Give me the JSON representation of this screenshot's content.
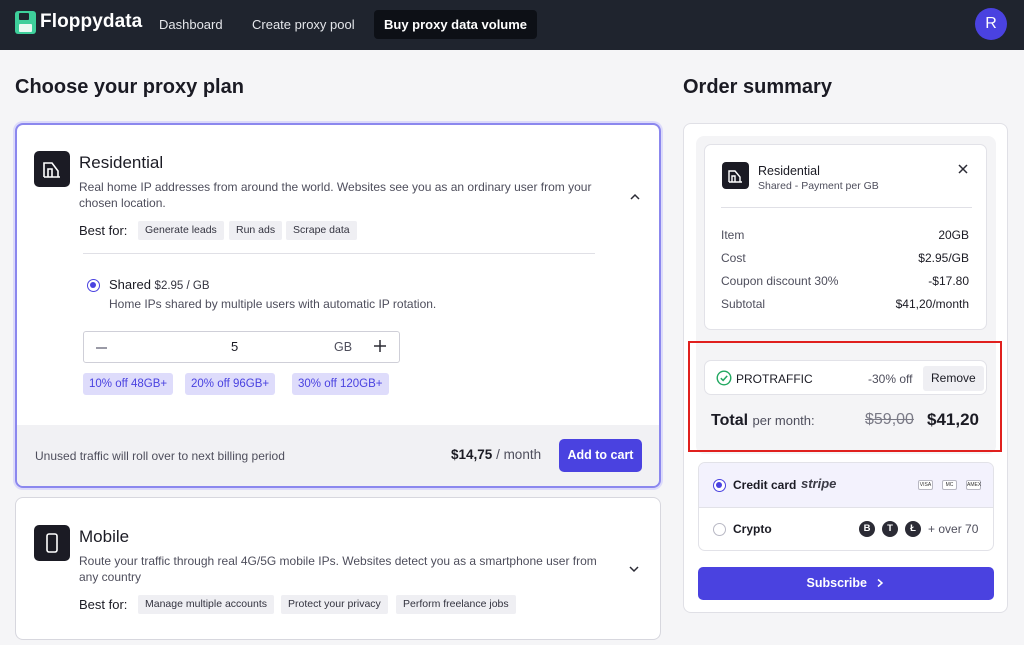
{
  "app": {
    "name": "Floppydata"
  },
  "nav": {
    "links": [
      {
        "label": "Dashboard"
      },
      {
        "label": "Create proxy pool"
      },
      {
        "label": "Buy proxy data volume"
      }
    ],
    "avatar_initial": "R"
  },
  "plans_heading": "Choose your proxy plan",
  "plans": [
    {
      "title": "Residential",
      "description_line1": "Real home IP addresses from around the world. Websites see you as an ordinary user from your",
      "description_line2": "chosen location.",
      "best_for_label": "Best for:",
      "tags": [
        "Generate leads",
        "Run ads",
        "Scrape data"
      ],
      "option": {
        "label": "Shared",
        "price": "$2.95 / GB",
        "description": "Home IPs shared by multiple users with automatic IP rotation."
      },
      "quantity": {
        "value": "5",
        "unit": "GB"
      },
      "discounts": [
        "10% off 48GB+",
        "20% off 96GB+",
        "30% off 120GB+"
      ],
      "footer_note": "Unused traffic will roll over to next billing period",
      "price": "$14,75",
      "price_period": "/ month",
      "add_to_cart_label": "Add to cart"
    },
    {
      "title": "Mobile",
      "description_line1": "Route your traffic through real 4G/5G mobile IPs. Websites detect you as a smartphone user from",
      "description_line2": "any country",
      "best_for_label": "Best for:",
      "tags": [
        "Manage multiple accounts",
        "Protect your privacy",
        "Perform freelance jobs"
      ]
    }
  ],
  "summary": {
    "heading": "Order summary",
    "item_title": "Residential",
    "item_subtitle": "Shared - Payment per GB",
    "rows": [
      {
        "label": "Item",
        "value": "20GB"
      },
      {
        "label": "Cost",
        "value": "$2.95/GB"
      },
      {
        "label": "Coupon discount 30%",
        "value": "-$17.80"
      },
      {
        "label": "Subtotal",
        "value": "$41,20/month"
      }
    ],
    "coupon": {
      "code": "PROTRAFFIC",
      "discount": "-30% off",
      "remove_label": "Remove"
    },
    "total": {
      "label": "Total",
      "per": "per month:",
      "old": "$59,00",
      "new": "$41,20"
    },
    "payment": {
      "credit": {
        "label": "Credit card",
        "provider": "stripe",
        "cards": [
          "VISA",
          "MC",
          "AMEX"
        ]
      },
      "crypto": {
        "label": "Crypto",
        "coins": [
          "B",
          "T",
          "Ł"
        ],
        "more": "+ over 70"
      }
    },
    "subscribe_label": "Subscribe"
  }
}
